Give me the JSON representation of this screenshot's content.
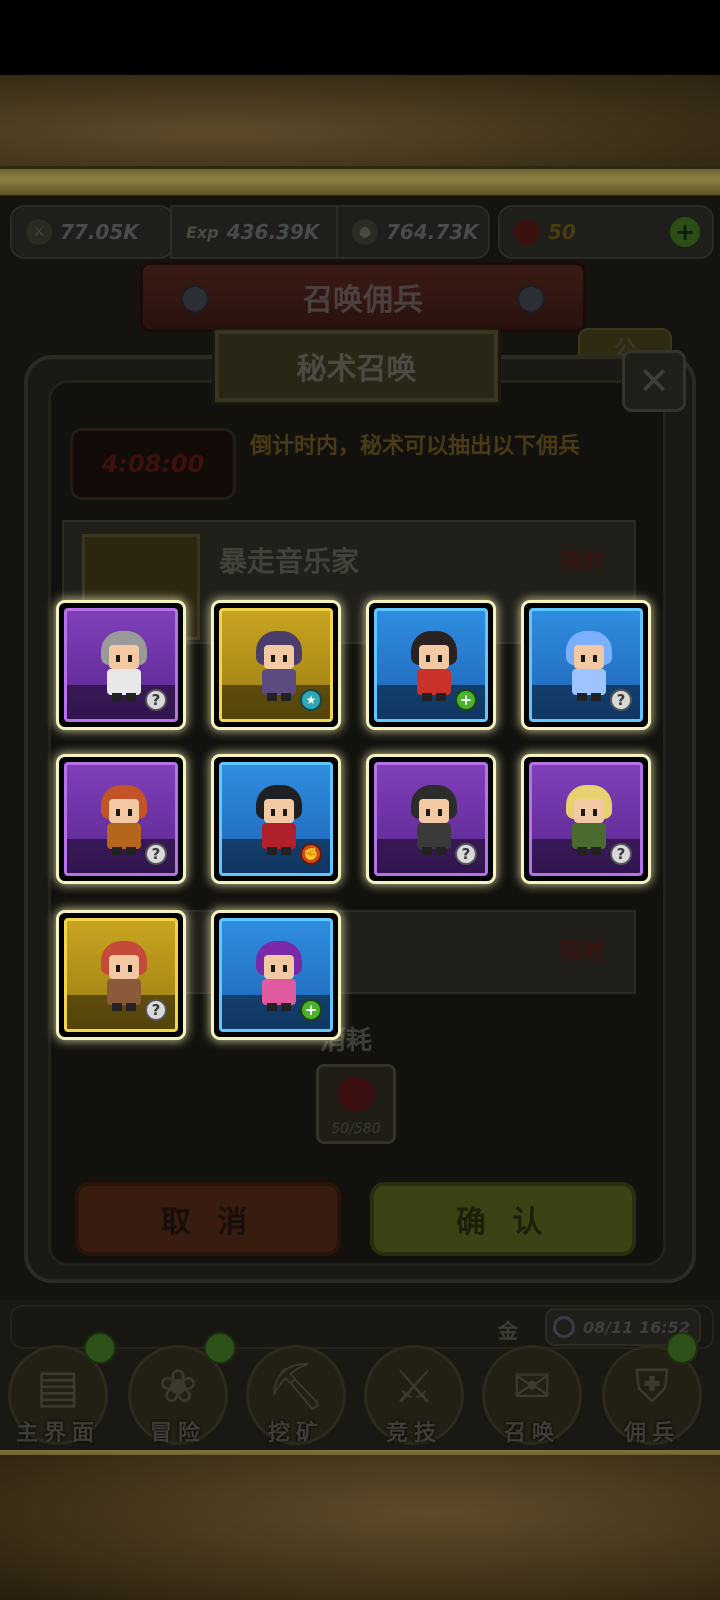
{
  "resources": {
    "sword": "77.05K",
    "exp": "436.39K",
    "coin": "764.73K",
    "gem": "50",
    "exp_tag": "Exp"
  },
  "banner_title": "召唤佣兵",
  "side_tab": "公",
  "dialog": {
    "title": "秘术召唤",
    "close": "✕",
    "timer": "4:08:00",
    "hint": "倒计时内，秘术可以抽出以下佣兵",
    "hero_rows": [
      {
        "name": "暴走音乐家",
        "tag": "限时"
      },
      {
        "name": "",
        "tag": "限时"
      }
    ],
    "consume_label": "消耗",
    "consume_count": "50/580",
    "cancel": "取 消",
    "confirm": "确 认"
  },
  "status": {
    "gold": "金",
    "time": "08/11 16:52"
  },
  "nav": [
    {
      "label": "主界面",
      "icon": "map-icon"
    },
    {
      "label": "冒险",
      "icon": "adventure-icon"
    },
    {
      "label": "挖矿",
      "icon": "pickaxe-icon"
    },
    {
      "label": "竞技",
      "icon": "crossed-swords-icon"
    },
    {
      "label": "召唤",
      "icon": "scroll-icon"
    },
    {
      "label": "佣兵",
      "icon": "armor-icon"
    }
  ],
  "heroes": [
    {
      "rarity": "purple",
      "badge": "help",
      "hair": "#9a9a9a",
      "outfit": "#e8e8e8"
    },
    {
      "rarity": "gold",
      "badge": "star",
      "hair": "#4b3d6a",
      "outfit": "#5c4b80"
    },
    {
      "rarity": "blue",
      "badge": "plus",
      "hair": "#2a2222",
      "outfit": "#c8322a"
    },
    {
      "rarity": "blue",
      "badge": "help",
      "hair": "#7cb0ff",
      "outfit": "#9ec4ff"
    },
    {
      "rarity": "purple",
      "badge": "help",
      "hair": "#c25428",
      "outfit": "#b4661c"
    },
    {
      "rarity": "blue",
      "badge": "fist",
      "hair": "#202024",
      "outfit": "#b0202a"
    },
    {
      "rarity": "purple",
      "badge": "help",
      "hair": "#2c2c2c",
      "outfit": "#3a3a3a"
    },
    {
      "rarity": "purple",
      "badge": "help",
      "hair": "#e8d070",
      "outfit": "#4a6a2e"
    },
    {
      "rarity": "gold",
      "badge": "help",
      "hair": "#c64a3a",
      "outfit": "#8a5a3a"
    },
    {
      "rarity": "blue",
      "badge": "plus",
      "hair": "#7a2aa8",
      "outfit": "#e05aa0"
    }
  ]
}
